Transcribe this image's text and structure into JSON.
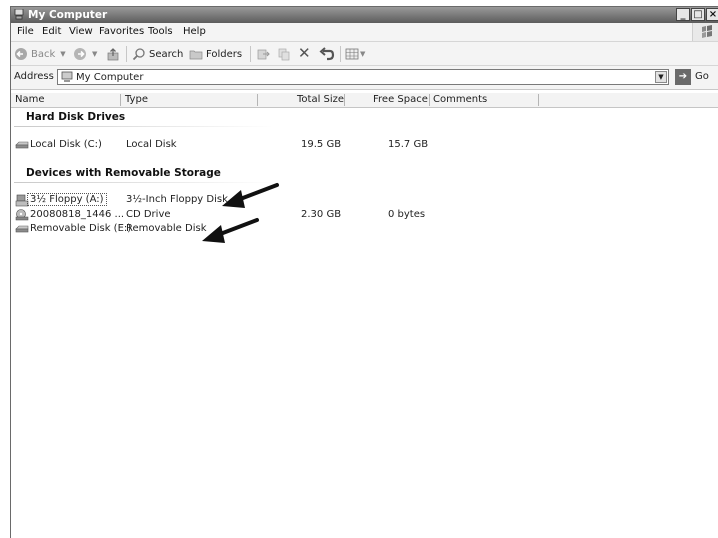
{
  "window": {
    "title": "My Computer"
  },
  "menu": [
    {
      "label": "File"
    },
    {
      "label": "Edit"
    },
    {
      "label": "View"
    },
    {
      "label": "Favorites"
    },
    {
      "label": "Tools"
    },
    {
      "label": "Help"
    }
  ],
  "toolbar": {
    "back": "Back",
    "search": "Search",
    "folders": "Folders"
  },
  "address": {
    "label": "Address",
    "value": "My Computer",
    "go": "Go"
  },
  "columns": [
    "Name",
    "Type",
    "Total Size",
    "Free Space",
    "Comments"
  ],
  "groups": [
    {
      "heading": "Hard Disk Drives",
      "items": [
        {
          "icon": "hard-disk-icon",
          "name": "Local Disk (C:)",
          "type": "Local Disk",
          "total": "19.5 GB",
          "free": "15.7 GB"
        }
      ]
    },
    {
      "heading": "Devices with Removable Storage",
      "items": [
        {
          "icon": "floppy-drive-icon",
          "name": "3½ Floppy (A:)",
          "type": "3½-Inch Floppy Disk",
          "total": "",
          "free": ""
        },
        {
          "icon": "cd-drive-icon",
          "name": "20080818_1446 ...",
          "type": "CD Drive",
          "total": "2.30 GB",
          "free": "0 bytes"
        },
        {
          "icon": "removable-disk-icon",
          "name": "Removable Disk (E:)",
          "type": "Removable Disk",
          "total": "",
          "free": ""
        }
      ]
    }
  ],
  "colors": {
    "titlebar": "#5c5c5c",
    "arrow": "#111111"
  }
}
